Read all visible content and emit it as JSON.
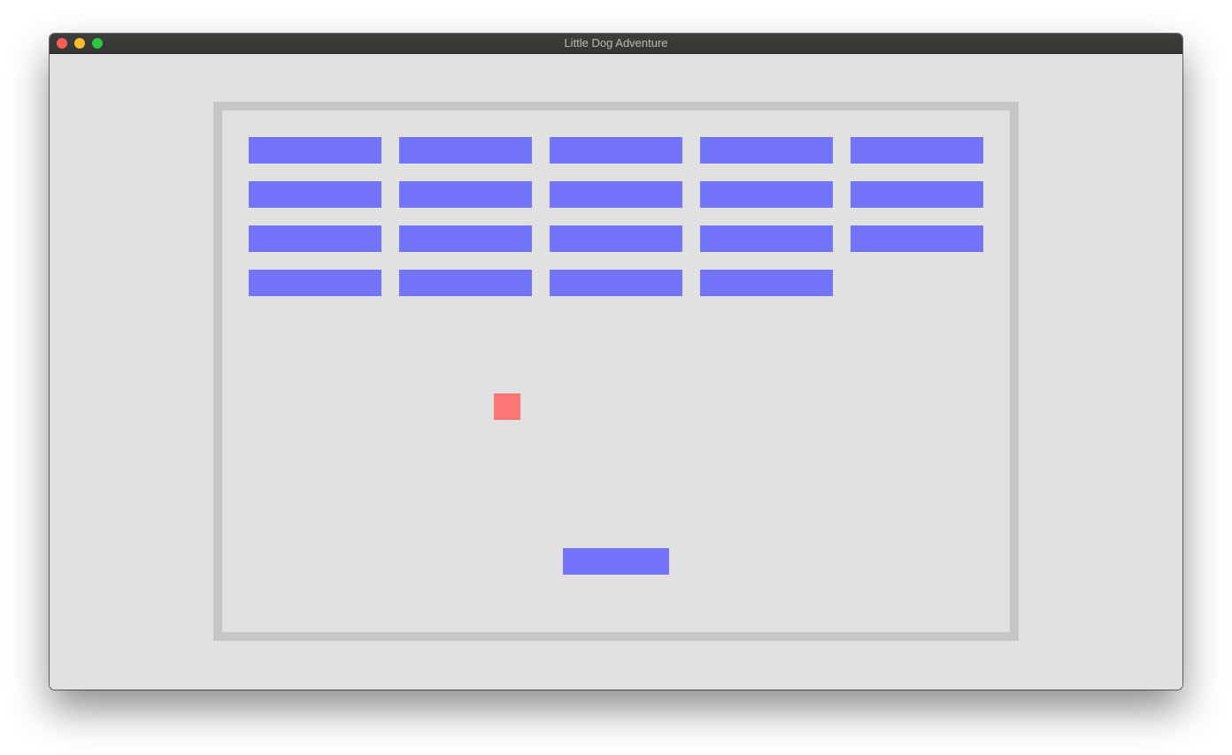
{
  "window": {
    "title": "Little Dog Adventure"
  },
  "colors": {
    "brick": "#7474fb",
    "paddle": "#7474fb",
    "ball": "#fd7676",
    "arena_border": "#c6c6c6",
    "background": "#e1e1e1"
  },
  "game": {
    "bricks": [
      {
        "row": 0,
        "col": 0
      },
      {
        "row": 0,
        "col": 1
      },
      {
        "row": 0,
        "col": 2
      },
      {
        "row": 0,
        "col": 3
      },
      {
        "row": 0,
        "col": 4
      },
      {
        "row": 1,
        "col": 0
      },
      {
        "row": 1,
        "col": 1
      },
      {
        "row": 1,
        "col": 2
      },
      {
        "row": 1,
        "col": 3
      },
      {
        "row": 1,
        "col": 4
      },
      {
        "row": 2,
        "col": 0
      },
      {
        "row": 2,
        "col": 1
      },
      {
        "row": 2,
        "col": 2
      },
      {
        "row": 2,
        "col": 3
      },
      {
        "row": 2,
        "col": 4
      },
      {
        "row": 3,
        "col": 0
      },
      {
        "row": 3,
        "col": 1
      },
      {
        "row": 3,
        "col": 2
      },
      {
        "row": 3,
        "col": 3
      }
    ]
  }
}
